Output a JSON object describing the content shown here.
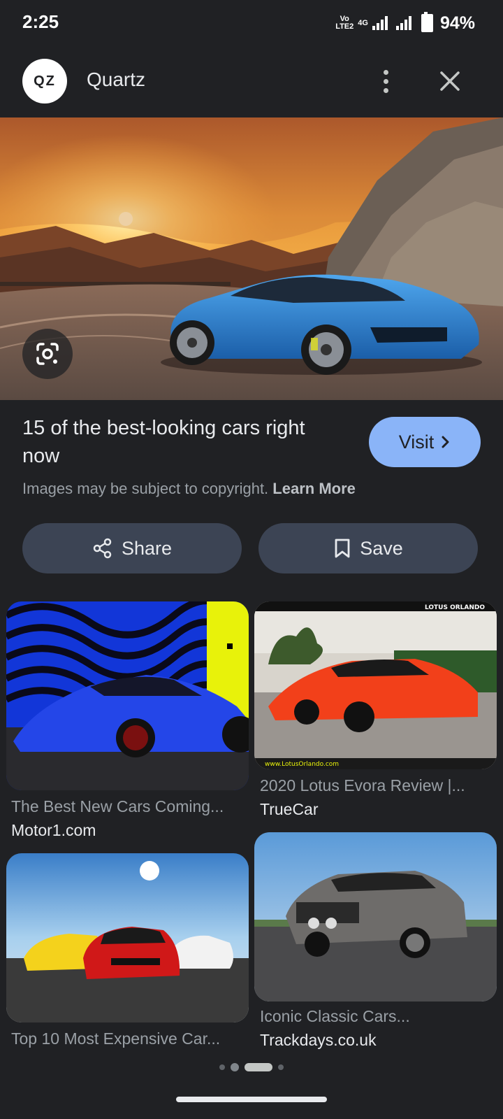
{
  "status_bar": {
    "time": "2:25",
    "volte_top": "Vo",
    "volte_bottom": "LTE2",
    "network": "4G",
    "battery": "94%"
  },
  "header": {
    "avatar_text": "QZ",
    "site_name": "Quartz",
    "more_icon": "more-vert-icon",
    "close_icon": "close-icon"
  },
  "hero": {
    "lens_icon": "google-lens-icon"
  },
  "article": {
    "title": "15 of the best-looking cars right now",
    "visit_label": "Visit",
    "copyright_text": "Images may be subject to copyright.",
    "learn_more": "Learn More"
  },
  "actions": {
    "share_label": "Share",
    "save_label": "Save"
  },
  "related": [
    {
      "title": "The Best New Cars Coming...",
      "source": "Motor1.com"
    },
    {
      "title": "2020 Lotus Evora Review |...",
      "source": "TrueCar"
    },
    {
      "title": "Top 10 Most Expensive Car...",
      "source": ""
    },
    {
      "title": "Iconic Classic Cars...",
      "source": "Trackdays.co.uk"
    }
  ],
  "image_text": {
    "lotus_orlando_banner": "LOTUS ORLANDO",
    "lotus_orlando_url": "www.LotusOrlando.com"
  },
  "colors": {
    "background": "#202124",
    "accent": "#8ab4f8",
    "pill": "#3c4454"
  }
}
